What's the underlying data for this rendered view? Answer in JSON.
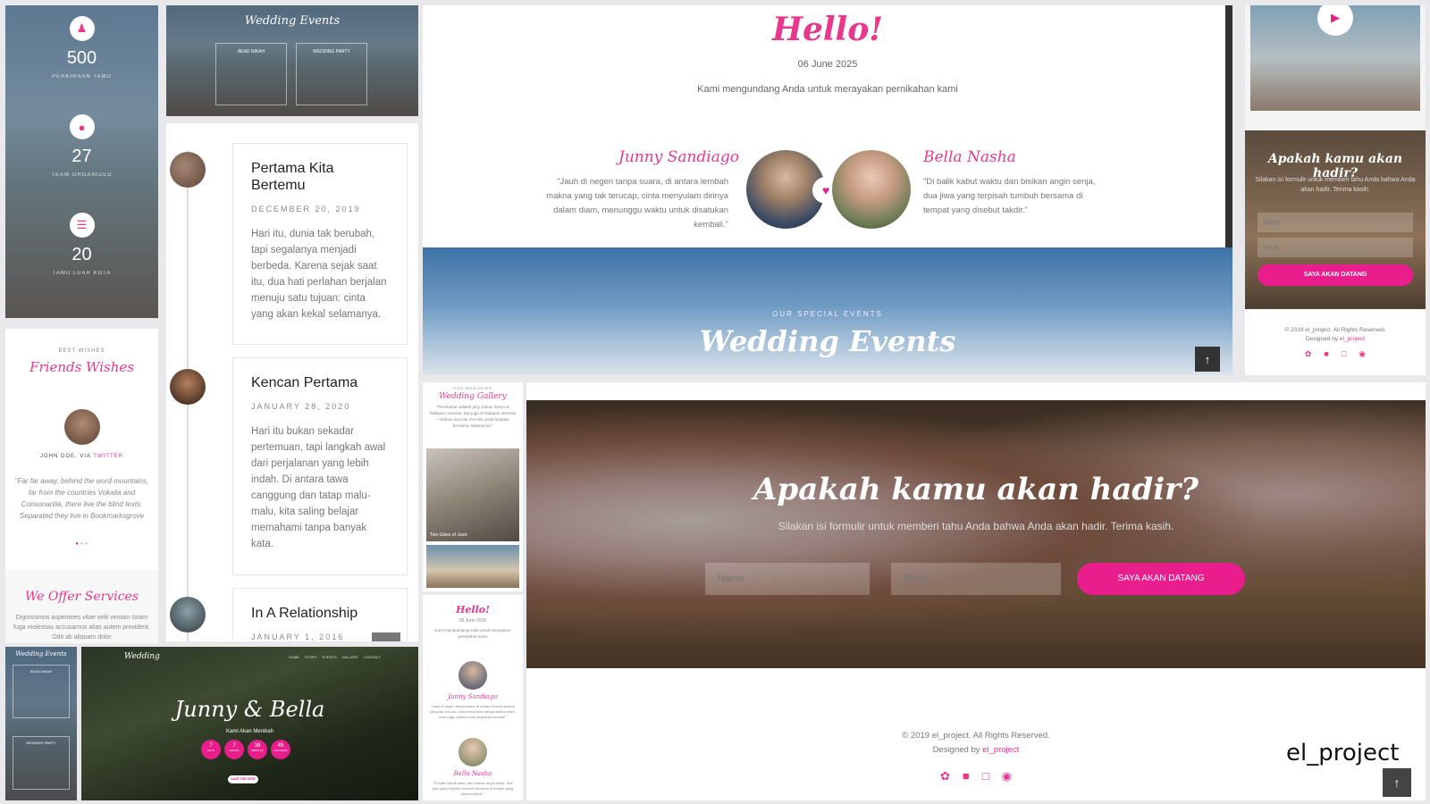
{
  "colors": {
    "accent": "#e91e8c",
    "script_pink": "#e8388d",
    "dark_overlay": "#2a2a2a"
  },
  "stats_panel": {
    "items": [
      {
        "value": "500",
        "label": "PERKIRAAN TAMU",
        "icon": "users-icon"
      },
      {
        "value": "27",
        "label": "TEAM ORGANIZED",
        "icon": "user-icon"
      },
      {
        "value": "20",
        "label": "TAMU LUAR KOTA",
        "icon": "book-icon"
      }
    ]
  },
  "events_thumb": {
    "title": "Wedding Events",
    "cards": [
      "AKAD NIKAH",
      "WEDDING PARTY"
    ]
  },
  "timeline": [
    {
      "title": "Pertama Kita Bertemu",
      "date": "DECEMBER 20, 2019",
      "text": "Hari itu, dunia tak berubah, tapi segalanya menjadi berbeda. Karena sejak saat itu, dua hati perlahan berjalan menuju satu tujuan: cinta yang akan kekal selamanya."
    },
    {
      "title": "Kencan Pertama",
      "date": "JANUARY 28, 2020",
      "text": "Hari itu bukan sekadar pertemuan, tapi langkah awal dari perjalanan yang lebih indah. Di antara tawa canggung dan tatap malu-malu, kita saling belajar memahami tanpa banyak kata."
    },
    {
      "title": "In A Relationship",
      "date": "JANUARY 1, 2016",
      "text": ""
    }
  ],
  "hello_section": {
    "title": "Hello!",
    "date": "06 June 2025",
    "subtitle": "Kami mengundang Anda untuk merayakan pernikahan kami",
    "groom": {
      "name": "Junny Sandiago",
      "quote": "\"Jauh di negeri tanpa suara, di antara lembah makna yang tak terucap, cinta menyulam dirinya dalam diam, menunggu waktu untuk disatukan kembali.\""
    },
    "bride": {
      "name": "Bella Nasha",
      "quote": "\"Di balik kabut waktu dan bisikan angin senja, dua jiwa yang terpisah tumbuh bersama di tempat yang disebut takdir.\""
    }
  },
  "events_banner": {
    "eyebrow": "OUR SPECIAL EVENTS",
    "title": "Wedding Events"
  },
  "rsvp_small": {
    "title": "Apakah kamu akan hadir?",
    "subtitle": "Silakan isi formulir untuk memberi tahu Anda bahwa Anda akan hadir. Terima kasih.",
    "name_placeholder": "Nama",
    "email_placeholder": "Email",
    "button": "SAYA AKAN DATANG"
  },
  "footer_small": {
    "copyright": "© 2019 el_project. All Rights Reserved.",
    "designed_by": "Designed by",
    "designer": "el_project"
  },
  "wishes": {
    "eyebrow": "BEST WISHES",
    "title": "Friends Wishes",
    "author": "JOHN DOE, VIA",
    "author_link": "TWITTER",
    "quote": "\"Far far away, behind the word mountains, far from the countries Vokalia and Consonantia, there live the blind texts. Separated they live in Bookmarksgrove right at the coast of",
    "services_title": "We Offer Services",
    "services_text": "Dignissimos asperiores vitae velit veniam totam fuga molestias accusamus alias autem provident. Odit ab aliquam dolor"
  },
  "gallery_mobile": {
    "eyebrow": "OUR MEMORIES",
    "title": "Wedding Gallery",
    "text": "\"Pernikahan adalah janji, bukan hanya di hadapan manusia, tapi juga di hadapan semesta—bahwa dua hati memilih untuk berjalan bersama, selamanya.\"",
    "caption": "Two Glass of Juice"
  },
  "hello_mobile": {
    "title": "Hello!",
    "date": "06 June 2025",
    "subtitle": "Kami mengundang Anda untuk merayakan pernikahan kami",
    "groom": "Junny Sandiago",
    "groom_quote": "\"Jauh di negeri tanpa suara, di antara lembah makna yang tak terucap, cinta menyulam dirinya dalam diam, menunggu waktu untuk disatukan kembali.\"",
    "bride": "Bella Nasha",
    "bride_quote": "\"Di balik kabut waktu dan bisikan angin senja, dua jiwa yang terpisah tumbuh bersama di tempat yang disebut takdir.\""
  },
  "rsvp_main": {
    "title": "Apakah kamu akan hadir?",
    "subtitle": "Silakan isi formulir untuk memberi tahu Anda bahwa Anda akan hadir. Terima kasih.",
    "name_placeholder": "Nama",
    "email_placeholder": "Email",
    "button": "SAYA AKAN DATANG"
  },
  "footer_main": {
    "copyright": "© 2019 el_project. All Rights Reserved.",
    "designed_by": "Designed by",
    "designer": "el_project"
  },
  "hero": {
    "logo": "Wedding",
    "nav": [
      "HOME",
      "STORY",
      "EVENTS",
      "GALLERY",
      "CONTACT"
    ],
    "title": "Junny & Bella",
    "subtitle": "Kami Akan Menikah",
    "countdown": [
      {
        "value": "7",
        "label": "DAYS"
      },
      {
        "value": "7",
        "label": "HOURS"
      },
      {
        "value": "38",
        "label": "MINUTES"
      },
      {
        "value": "49",
        "label": "SECONDS"
      }
    ],
    "button": "SAVE THE DATE"
  },
  "events_mobile": {
    "title": "Wedding Events",
    "cards": [
      "AKAD NIKAH",
      "WEDDING PARTY"
    ]
  },
  "brand_watermark": "el_project"
}
